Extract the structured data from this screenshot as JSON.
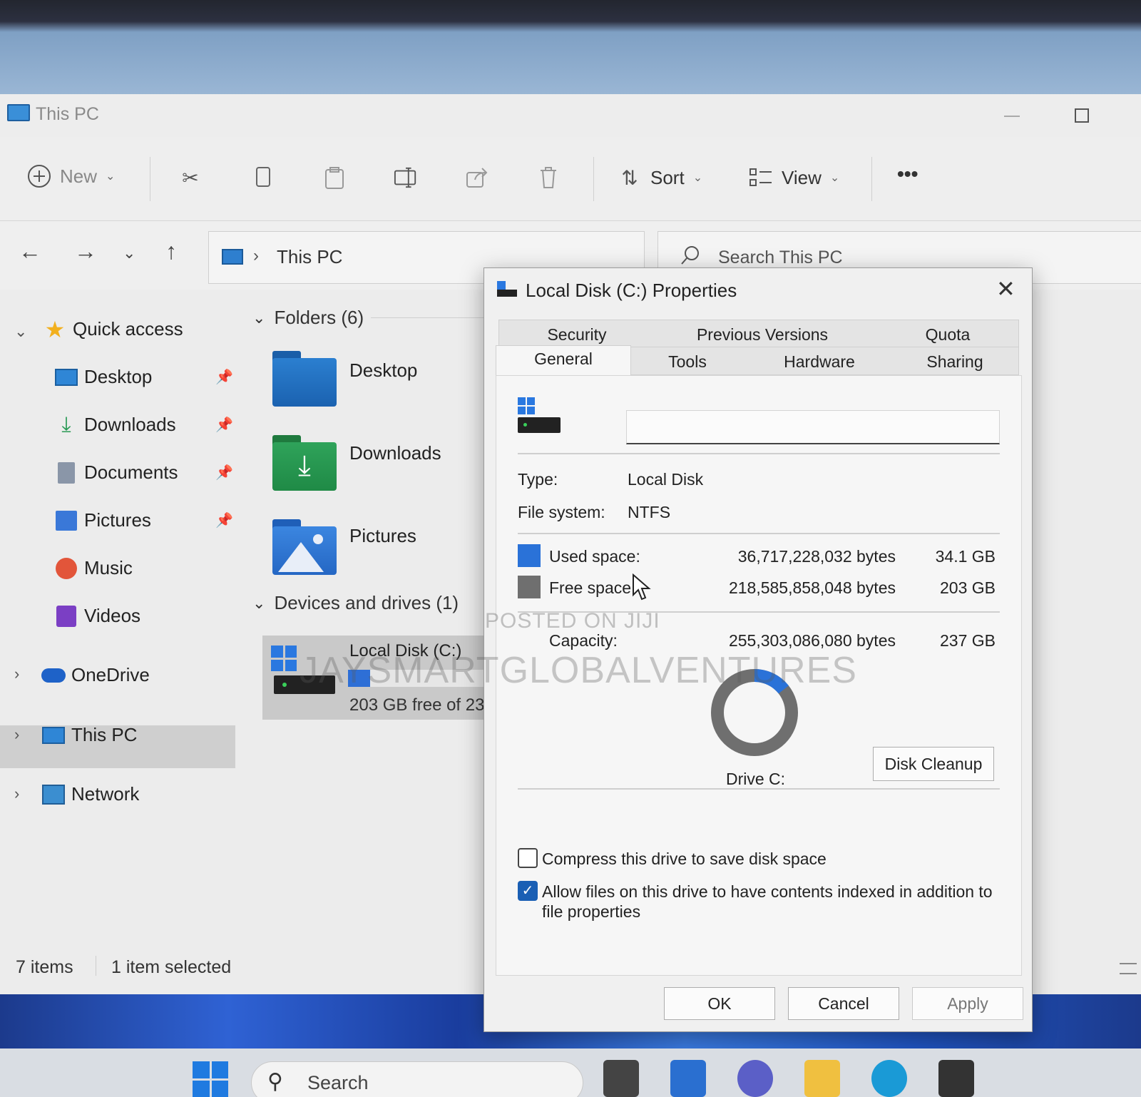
{
  "explorer": {
    "title": "This PC",
    "toolbar": {
      "new_label": "New",
      "sort_label": "Sort",
      "view_label": "View",
      "more_label": "•••"
    },
    "address": {
      "location": "This PC",
      "search_placeholder": "Search This PC"
    },
    "sidebar": {
      "quick_access": "Quick access",
      "items": [
        {
          "label": "Desktop",
          "icon": "desktop-icon"
        },
        {
          "label": "Downloads",
          "icon": "download-icon"
        },
        {
          "label": "Documents",
          "icon": "documents-icon"
        },
        {
          "label": "Pictures",
          "icon": "pictures-icon"
        },
        {
          "label": "Music",
          "icon": "music-icon"
        },
        {
          "label": "Videos",
          "icon": "videos-icon"
        }
      ],
      "onedrive": "OneDrive",
      "this_pc": "This PC",
      "network": "Network"
    },
    "folders": {
      "header": "Folders (6)",
      "items": [
        "Desktop",
        "Downloads",
        "Pictures"
      ]
    },
    "devices": {
      "header": "Devices and drives (1)",
      "drive_name": "Local Disk (C:)",
      "drive_free": "203 GB free of 23",
      "used_fraction": 0.14
    },
    "status": {
      "items": "7 items",
      "selected": "1 item selected"
    }
  },
  "dialog": {
    "title": "Local Disk (C:) Properties",
    "tabs_top": [
      "Security",
      "Previous Versions",
      "Quota"
    ],
    "tabs_bottom": [
      "General",
      "Tools",
      "Hardware",
      "Sharing"
    ],
    "volume_label_value": "",
    "type_label": "Type:",
    "type_value": "Local Disk",
    "fs_label": "File system:",
    "fs_value": "NTFS",
    "used_label": "Used space:",
    "used_bytes": "36,717,228,032 bytes",
    "used_gb": "34.1 GB",
    "free_label": "Free space:",
    "free_bytes": "218,585,858,048 bytes",
    "free_gb": "203 GB",
    "capacity_label": "Capacity:",
    "capacity_bytes": "255,303,086,080 bytes",
    "capacity_gb": "237 GB",
    "drive_label": "Drive C:",
    "used_fraction": 0.1438,
    "cleanup_label": "Disk Cleanup",
    "compress_label": "Compress this drive to save disk space",
    "compress_checked": false,
    "index_label_1": "Allow files on this drive to have contents indexed in addition to",
    "index_label_2": "file properties",
    "index_checked": true,
    "ok_label": "OK",
    "cancel_label": "Cancel",
    "apply_label": "Apply",
    "colors": {
      "used": "#2a72d8",
      "free": "#6f6f6f"
    }
  },
  "watermarks": {
    "small": "POSTED ON JIJI",
    "big": "JAYSMARTGLOBALVENTURES"
  },
  "taskbar": {
    "search_label": "Search"
  }
}
